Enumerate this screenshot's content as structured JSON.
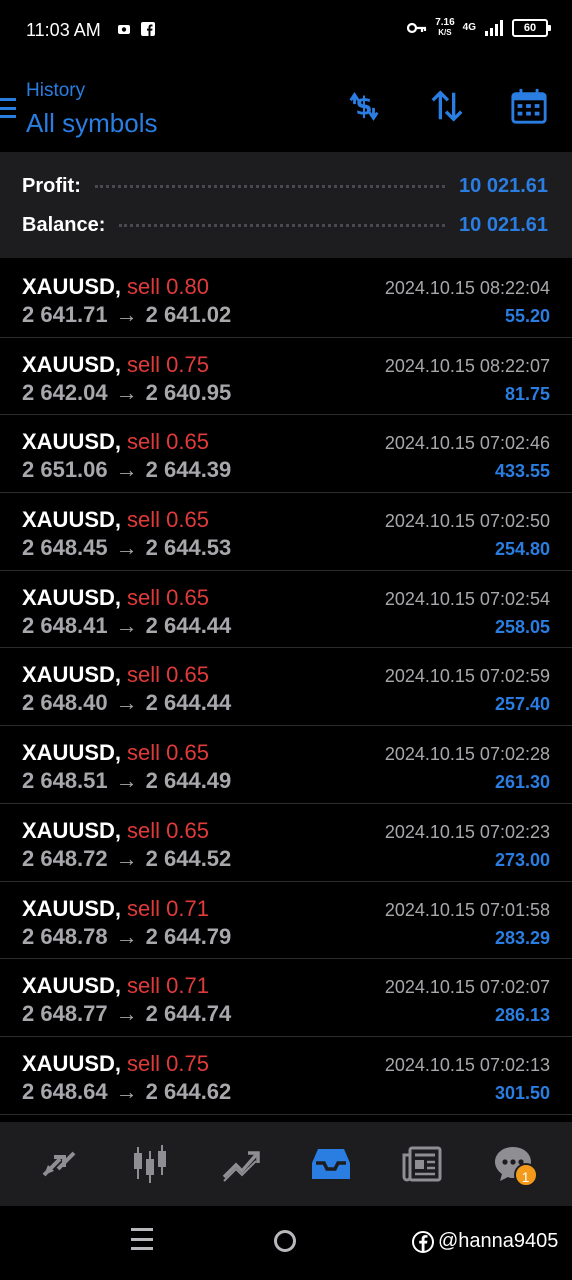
{
  "status_bar": {
    "time": "11:03 AM",
    "net_speed_value": "7.16",
    "net_speed_unit": "K/S",
    "net_type": "4G",
    "battery": "60"
  },
  "header": {
    "subtitle": "History",
    "title": "All symbols",
    "icons": [
      "currency-exchange-icon",
      "sort-icon",
      "calendar-icon"
    ]
  },
  "summary": {
    "profit_label": "Profit:",
    "profit_value": "10 021.61",
    "balance_label": "Balance:",
    "balance_value": "10 021.61"
  },
  "deals": [
    {
      "symbol": "XAUUSD,",
      "side": "sell 0.80",
      "open": "2 641.71",
      "close": "2 641.02",
      "time": "2024.10.15 08:22:04",
      "profit": "55.20"
    },
    {
      "symbol": "XAUUSD,",
      "side": "sell 0.75",
      "open": "2 642.04",
      "close": "2 640.95",
      "time": "2024.10.15 08:22:07",
      "profit": "81.75"
    },
    {
      "symbol": "XAUUSD,",
      "side": "sell 0.65",
      "open": "2 651.06",
      "close": "2 644.39",
      "time": "2024.10.15 07:02:46",
      "profit": "433.55"
    },
    {
      "symbol": "XAUUSD,",
      "side": "sell 0.65",
      "open": "2 648.45",
      "close": "2 644.53",
      "time": "2024.10.15 07:02:50",
      "profit": "254.80"
    },
    {
      "symbol": "XAUUSD,",
      "side": "sell 0.65",
      "open": "2 648.41",
      "close": "2 644.44",
      "time": "2024.10.15 07:02:54",
      "profit": "258.05"
    },
    {
      "symbol": "XAUUSD,",
      "side": "sell 0.65",
      "open": "2 648.40",
      "close": "2 644.44",
      "time": "2024.10.15 07:02:59",
      "profit": "257.40"
    },
    {
      "symbol": "XAUUSD,",
      "side": "sell 0.65",
      "open": "2 648.51",
      "close": "2 644.49",
      "time": "2024.10.15 07:02:28",
      "profit": "261.30"
    },
    {
      "symbol": "XAUUSD,",
      "side": "sell 0.65",
      "open": "2 648.72",
      "close": "2 644.52",
      "time": "2024.10.15 07:02:23",
      "profit": "273.00"
    },
    {
      "symbol": "XAUUSD,",
      "side": "sell 0.71",
      "open": "2 648.78",
      "close": "2 644.79",
      "time": "2024.10.15 07:01:58",
      "profit": "283.29"
    },
    {
      "symbol": "XAUUSD,",
      "side": "sell 0.71",
      "open": "2 648.77",
      "close": "2 644.74",
      "time": "2024.10.15 07:02:07",
      "profit": "286.13"
    },
    {
      "symbol": "XAUUSD,",
      "side": "sell 0.75",
      "open": "2 648.64",
      "close": "2 644.62",
      "time": "2024.10.15 07:02:13",
      "profit": "301.50"
    }
  ],
  "bottom_nav": {
    "items": [
      "quotes-icon",
      "chart-icon",
      "trade-icon",
      "history-icon",
      "news-icon",
      "chat-icon"
    ],
    "active": "history-icon",
    "chat_badge": "1"
  },
  "watermark": "@hanna9405",
  "colors": {
    "accent": "#2a7de1",
    "sell": "#e03a3a",
    "muted": "#a8a8ac",
    "panel": "#1d1d1f",
    "badge": "#f39a1b"
  }
}
